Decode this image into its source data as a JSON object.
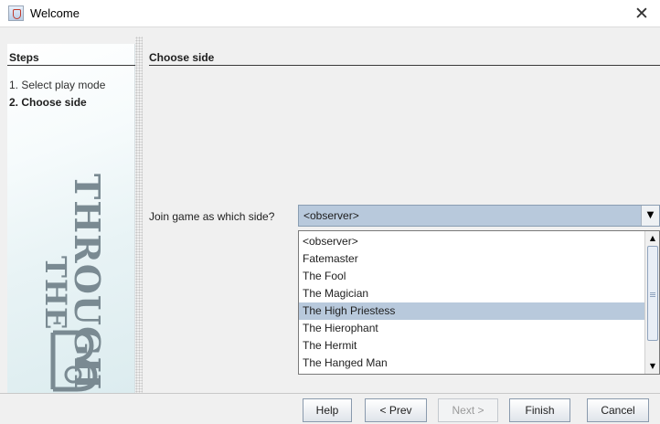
{
  "window": {
    "title": "Welcome",
    "close_glyph": "✕"
  },
  "steps": {
    "title": "Steps",
    "items": [
      {
        "label": "1. Select play mode",
        "active": false
      },
      {
        "label": "2. Choose side",
        "active": true
      }
    ],
    "logo_text": [
      "THROUGH",
      "THE"
    ]
  },
  "main": {
    "title": "Choose side",
    "join_label": "Join game as which side?",
    "combo": {
      "value": "<observer>"
    },
    "options": [
      "<observer>",
      "Fatemaster",
      "The Fool",
      "The Magician",
      "The High Priestess",
      "The Hierophant",
      "The Hermit",
      "The Hanged Man"
    ],
    "highlighted_option": "The High Priestess"
  },
  "buttons": {
    "help": "Help",
    "prev": "< Prev",
    "next": "Next >",
    "finish": "Finish",
    "cancel": "Cancel"
  },
  "colors": {
    "selection": "#b8c9dc",
    "background": "#f0f0f0"
  },
  "icons": {
    "app": "java-cup-icon",
    "close": "close-icon",
    "dropdown": "chevron-down-icon"
  }
}
